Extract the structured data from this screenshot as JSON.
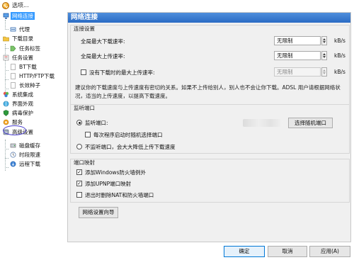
{
  "window": {
    "title": "选项..."
  },
  "tree": {
    "items": [
      {
        "label": "网络连接",
        "icon": "network-icon",
        "selected": true
      },
      {
        "label": "代理",
        "icon": "proxy-icon"
      },
      {
        "label": "下载目录",
        "icon": "folder-icon"
      },
      {
        "label": "任务标签",
        "icon": "tag-icon"
      },
      {
        "label": "任务设置",
        "icon": "task-settings-icon"
      },
      {
        "label": "BT下载",
        "icon": "page-icon"
      },
      {
        "label": "HTTP/FTP下载",
        "icon": "page-icon"
      },
      {
        "label": "长效种子",
        "icon": "page-icon"
      },
      {
        "label": "系统集成",
        "icon": "integration-icon"
      },
      {
        "label": "界面外观",
        "icon": "appearance-icon"
      },
      {
        "label": "病毒保护",
        "icon": "shield-icon"
      },
      {
        "label": "服务",
        "icon": "service-icon"
      },
      {
        "label": "高级设置",
        "icon": "advanced-icon"
      },
      {
        "label": "磁盘缓存",
        "icon": "disk-icon"
      },
      {
        "label": "时段限速",
        "icon": "clock-icon"
      },
      {
        "label": "远程下载",
        "icon": "remote-icon"
      }
    ]
  },
  "panel": {
    "header": "网络连接",
    "connection": {
      "title": "连接设置",
      "max_download_label": "全局最大下载速率:",
      "max_download_value": "无限制",
      "max_upload_label": "全局最大上传速率:",
      "max_upload_value": "无限制",
      "no_task_upload_label": "没有下载时的最大上传速率:",
      "no_task_upload_value": "无限制",
      "unit": "kB/s",
      "info": "建议你的下载速度与上传速度有密切的关系。如果不上传给别人，别人也不会让你下载。ADSL 用户请根据网络状况，适当的上传速度，以提高下载速度。"
    },
    "listen": {
      "title": "监听端口",
      "port_label": "监听端口:",
      "random_button": "选择随机端口",
      "random_each_start_label": "每次程序启动时随机选择端口",
      "no_listen_label": "不监听端口，会大大降低上传下载速度"
    },
    "mapping": {
      "title": "端口映射",
      "firewall_label": "添加Windows防火墙例外",
      "upnp_label": "添加UPNP端口映射",
      "remove_label": "退出时删除NAT和防火墙端口"
    },
    "wizard_button": "网络设置向导"
  },
  "footer": {
    "ok": "确定",
    "cancel": "取消",
    "apply": "应用(A)"
  }
}
